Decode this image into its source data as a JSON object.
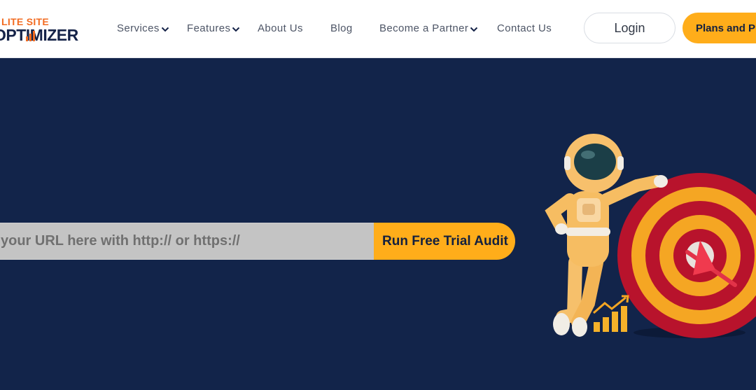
{
  "brand": {
    "logo_top": "LITE SITE",
    "logo_main": "OPTIMIZER",
    "logo_main_left": "OPT",
    "logo_main_right": "ZER"
  },
  "nav": {
    "services": "Services",
    "features": "Features",
    "about": "About Us",
    "blog": "Blog",
    "partner": "Become a Partner",
    "contact": "Contact Us"
  },
  "header_actions": {
    "login": "Login",
    "plans": "Plans and P"
  },
  "hero": {
    "url_placeholder": "your URL here with http:// or https://",
    "audit_button": "Run Free Trial Audit"
  },
  "icons": [
    "chevron-down-icon",
    "astronaut-illustration",
    "target-illustration",
    "growth-chart-icon"
  ],
  "colors": {
    "accent": "#ffad1a",
    "hero_bg": "#12244a",
    "logo_orange": "#f26b21",
    "logo_navy": "#152348"
  }
}
